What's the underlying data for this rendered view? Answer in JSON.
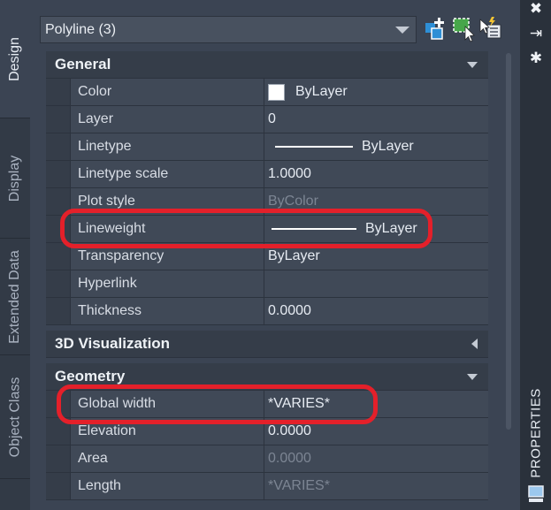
{
  "left_tabs": [
    "Design",
    "Display",
    "Extended Data",
    "Object Class"
  ],
  "selector": {
    "value": "Polyline (3)"
  },
  "toolbar": {
    "icons": [
      "add-to-selection-icon",
      "quick-select-icon",
      "select-objects-icon"
    ]
  },
  "sections": {
    "general": {
      "title": "General",
      "rows": [
        {
          "name": "Color",
          "value": "ByLayer"
        },
        {
          "name": "Layer",
          "value": "0"
        },
        {
          "name": "Linetype",
          "value": "ByLayer"
        },
        {
          "name": "Linetype scale",
          "value": "1.0000"
        },
        {
          "name": "Plot style",
          "value": "ByColor"
        },
        {
          "name": "Lineweight",
          "value": "ByLayer"
        },
        {
          "name": "Transparency",
          "value": "ByLayer"
        },
        {
          "name": "Hyperlink",
          "value": ""
        },
        {
          "name": "Thickness",
          "value": "0.0000"
        }
      ]
    },
    "viz3d": {
      "title": "3D Visualization"
    },
    "geometry": {
      "title": "Geometry",
      "rows": [
        {
          "name": "Global width",
          "value": "*VARIES*"
        },
        {
          "name": "Elevation",
          "value": "0.0000"
        },
        {
          "name": "Area",
          "value": "0.0000"
        },
        {
          "name": "Length",
          "value": "*VARIES*"
        }
      ]
    }
  },
  "right_bar": {
    "label": "PROPERTIES",
    "icons": [
      "close-icon",
      "auto-hide-icon",
      "settings-icon"
    ]
  },
  "colors": {
    "highlight": "#e4202a",
    "panel": "#3b4453"
  }
}
